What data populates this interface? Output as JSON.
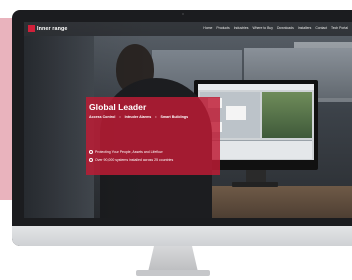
{
  "header": {
    "logo_text": "Inner range",
    "logo_icon": "inner-range-logo-icon",
    "nav": [
      "Home",
      "Products",
      "Industries",
      "Where to Buy",
      "Downloads",
      "Installers",
      "Contact",
      "Tech Portal"
    ]
  },
  "hero": {
    "title": "Global Leader",
    "subtitle": [
      "Access Control",
      "Intruder Alarms",
      "Smart Buildings"
    ],
    "separator": "•",
    "bullets": [
      "Protecting Your People, Assets and Lifeflow",
      "Over 90,000 systems installed across 25 countries"
    ]
  },
  "colors": {
    "brand_red": "#d1203a",
    "hero_overlay": "#be1c34",
    "side_panel": "#e9b3bd"
  }
}
